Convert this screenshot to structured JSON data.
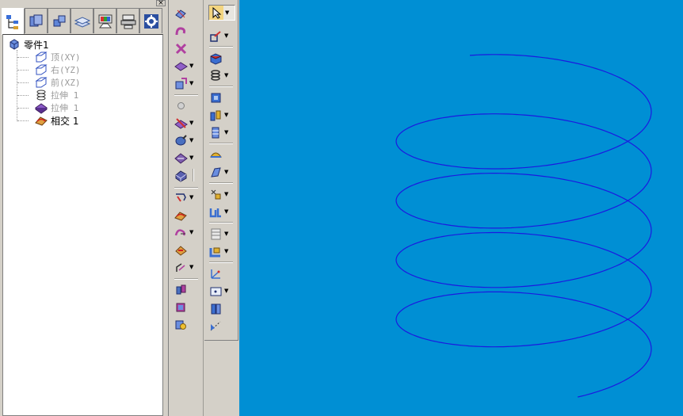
{
  "window": {
    "close_glyph": "×"
  },
  "left_tabs": [
    {
      "icon": "model-tree-icon"
    },
    {
      "icon": "layer-icon"
    },
    {
      "icon": "feature-icon"
    },
    {
      "icon": "layers-stack-icon"
    },
    {
      "icon": "colors-icon"
    },
    {
      "icon": "display-icon"
    },
    {
      "icon": "settings-gear-icon"
    }
  ],
  "tree": {
    "root": {
      "label": "零件1",
      "icon": "part-icon"
    },
    "items": [
      {
        "label": "顶(XY)",
        "icon": "datum-plane-icon",
        "muted": true
      },
      {
        "label": "右(YZ)",
        "icon": "datum-plane-icon",
        "muted": true
      },
      {
        "label": "前(XZ)",
        "icon": "datum-plane-icon",
        "muted": true
      },
      {
        "label": "拉伸 1",
        "icon": "extrude-icon",
        "muted": true
      },
      {
        "label": "拉伸 1",
        "icon": "extrude-solid-icon",
        "muted": true
      },
      {
        "label": "相交 1",
        "icon": "intersect-icon",
        "muted": false
      }
    ]
  },
  "toolbar_left": [
    {
      "icon": "sketch-icon"
    },
    {
      "icon": "curve-icon"
    },
    {
      "icon": "point-icon"
    },
    {
      "icon": "surface-icon",
      "dropdown": "▼"
    },
    {
      "icon": "solid-icon",
      "dropdown": "▼"
    },
    {
      "icon": "sphere-icon"
    },
    {
      "icon": "cut-icon",
      "dropdown": "▼"
    },
    {
      "icon": "revolve-icon",
      "dropdown": "▼"
    },
    {
      "icon": "sweep-icon",
      "dropdown": "▼"
    },
    {
      "icon": "loft-icon"
    },
    {
      "icon": "split-icon",
      "dropdown": "▼"
    },
    {
      "icon": "edge-blend-icon"
    },
    {
      "icon": "chamfer-icon",
      "dropdown": "▼"
    },
    {
      "icon": "shell-icon"
    },
    {
      "icon": "mirror-icon",
      "dropdown": "▼"
    },
    {
      "icon": "pattern-icon"
    },
    {
      "icon": "box-icon"
    },
    {
      "icon": "link-icon"
    }
  ],
  "toolbar_right": [
    {
      "icon": "select-arrow-icon",
      "dropdown": "▼",
      "pressed": true
    },
    {
      "icon": "edit-curve-icon",
      "dropdown": "▼"
    },
    {
      "icon": "cube-face-icon"
    },
    {
      "icon": "spring-icon",
      "dropdown": "▼"
    },
    {
      "icon": "blue-box-icon"
    },
    {
      "icon": "wall-icon",
      "dropdown": "▼"
    },
    {
      "icon": "ribbon-icon",
      "dropdown": "▼"
    },
    {
      "icon": "dome-icon"
    },
    {
      "icon": "patch-icon",
      "dropdown": "▼"
    },
    {
      "icon": "transform-icon",
      "dropdown": "▼"
    },
    {
      "icon": "sheet-metal-icon",
      "dropdown": "▼"
    },
    {
      "icon": "table-icon",
      "dropdown": "▼"
    },
    {
      "icon": "flange-icon",
      "dropdown": "▼"
    },
    {
      "icon": "axis-icon"
    },
    {
      "icon": "dimension-box-icon",
      "dropdown": "▼"
    },
    {
      "icon": "cylinder-icon"
    },
    {
      "icon": "measure-icon"
    }
  ],
  "viewport": {
    "background": "#008fd4",
    "curve_color": "#1a1ae0",
    "object": "helix"
  }
}
